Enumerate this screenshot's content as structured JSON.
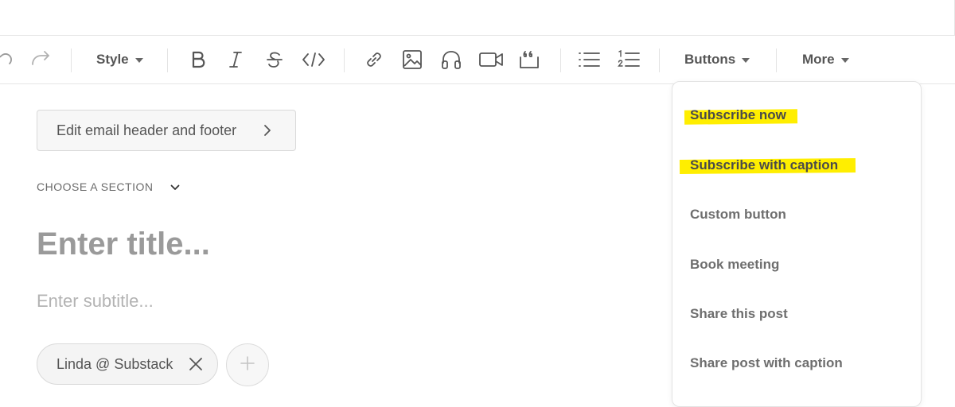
{
  "toolbar": {
    "style_label": "Style",
    "buttons_label": "Buttons",
    "more_label": "More"
  },
  "editor": {
    "edit_header_footer_label": "Edit email header and footer",
    "choose_section_label": "CHOOSE A SECTION",
    "title_placeholder": "Enter title...",
    "subtitle_placeholder": "Enter subtitle...",
    "author_chip_label": "Linda @ Substack"
  },
  "buttons_menu": {
    "items": [
      {
        "label": "Subscribe now",
        "highlighted": true
      },
      {
        "label": "Subscribe with caption",
        "highlighted": true
      },
      {
        "label": "Custom button",
        "highlighted": false
      },
      {
        "label": "Book meeting",
        "highlighted": false
      },
      {
        "label": "Share this post",
        "highlighted": false
      },
      {
        "label": "Share post with caption",
        "highlighted": false
      }
    ],
    "highlight_color": "#ffee00"
  },
  "colors": {
    "icon": "#555555",
    "border": "#e6e6e6"
  }
}
